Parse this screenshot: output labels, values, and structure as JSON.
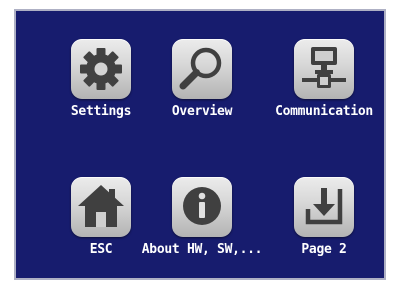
{
  "menu": {
    "items": [
      {
        "label": "Settings",
        "icon": "gear-icon"
      },
      {
        "label": "Overview",
        "icon": "magnifier-icon"
      },
      {
        "label": "Communication",
        "icon": "network-icon"
      },
      {
        "label": "ESC",
        "icon": "home-icon"
      },
      {
        "label": "About HW, SW,...",
        "icon": "info-icon"
      },
      {
        "label": "Page 2",
        "icon": "page-down-icon"
      }
    ]
  },
  "colors": {
    "background": "#171c6e",
    "border": "#aeb0c4",
    "icon_button": "#cfcfcf",
    "icon_glyph": "#404040",
    "label_text": "#ffffff"
  }
}
